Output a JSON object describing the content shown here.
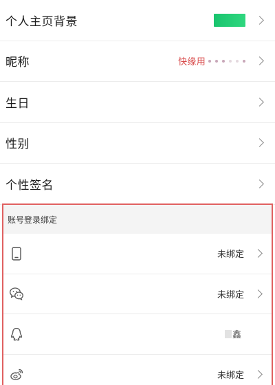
{
  "profile": {
    "rows": [
      {
        "label": "个人主页背景"
      },
      {
        "label": "昵称",
        "value": "快缘用"
      },
      {
        "label": "生日"
      },
      {
        "label": "性别"
      },
      {
        "label": "个性签名"
      }
    ],
    "background_thumb_color": "#1fcc73",
    "nickname_color": "#d84a4a"
  },
  "binding": {
    "title": "账号登录绑定",
    "highlight_color": "#e06060",
    "rows": [
      {
        "icon": "phone-icon",
        "value": "未绑定"
      },
      {
        "icon": "wechat-icon",
        "value": "未绑定"
      },
      {
        "icon": "qq-icon",
        "value": "鑫"
      },
      {
        "icon": "weibo-icon",
        "value": "未绑定"
      }
    ]
  }
}
